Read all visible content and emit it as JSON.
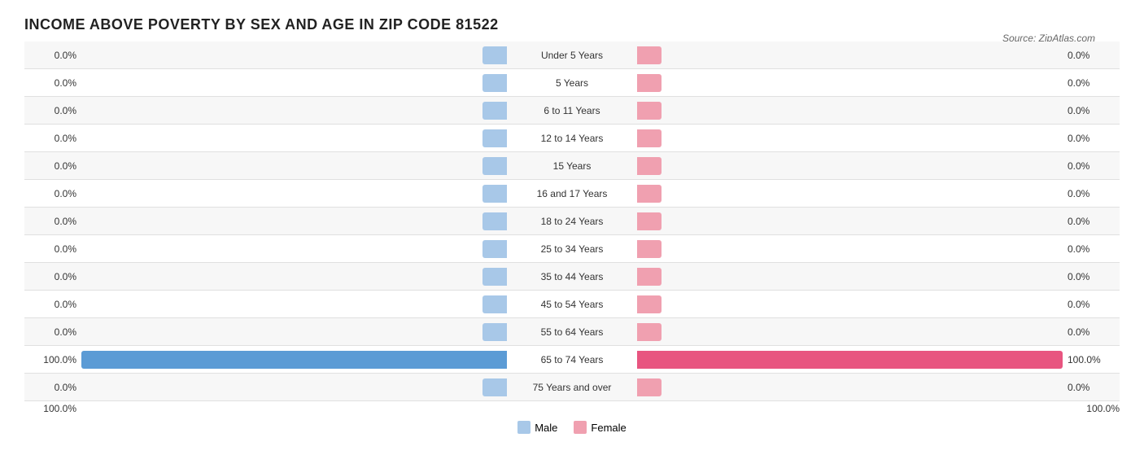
{
  "title": "INCOME ABOVE POVERTY BY SEX AND AGE IN ZIP CODE 81522",
  "source": "Source: ZipAtlas.com",
  "chart": {
    "rows": [
      {
        "label": "Under 5 Years",
        "male": 0.0,
        "female": 0.0,
        "maleDisplay": "0.0%",
        "femaleDisplay": "0.0%",
        "highlight": false
      },
      {
        "label": "5 Years",
        "male": 0.0,
        "female": 0.0,
        "maleDisplay": "0.0%",
        "femaleDisplay": "0.0%",
        "highlight": false
      },
      {
        "label": "6 to 11 Years",
        "male": 0.0,
        "female": 0.0,
        "maleDisplay": "0.0%",
        "femaleDisplay": "0.0%",
        "highlight": false
      },
      {
        "label": "12 to 14 Years",
        "male": 0.0,
        "female": 0.0,
        "maleDisplay": "0.0%",
        "femaleDisplay": "0.0%",
        "highlight": false
      },
      {
        "label": "15 Years",
        "male": 0.0,
        "female": 0.0,
        "maleDisplay": "0.0%",
        "femaleDisplay": "0.0%",
        "highlight": false
      },
      {
        "label": "16 and 17 Years",
        "male": 0.0,
        "female": 0.0,
        "maleDisplay": "0.0%",
        "femaleDisplay": "0.0%",
        "highlight": false
      },
      {
        "label": "18 to 24 Years",
        "male": 0.0,
        "female": 0.0,
        "maleDisplay": "0.0%",
        "femaleDisplay": "0.0%",
        "highlight": false
      },
      {
        "label": "25 to 34 Years",
        "male": 0.0,
        "female": 0.0,
        "maleDisplay": "0.0%",
        "femaleDisplay": "0.0%",
        "highlight": false
      },
      {
        "label": "35 to 44 Years",
        "male": 0.0,
        "female": 0.0,
        "maleDisplay": "0.0%",
        "femaleDisplay": "0.0%",
        "highlight": false
      },
      {
        "label": "45 to 54 Years",
        "male": 0.0,
        "female": 0.0,
        "maleDisplay": "0.0%",
        "femaleDisplay": "0.0%",
        "highlight": false
      },
      {
        "label": "55 to 64 Years",
        "male": 0.0,
        "female": 0.0,
        "maleDisplay": "0.0%",
        "femaleDisplay": "0.0%",
        "highlight": false
      },
      {
        "label": "65 to 74 Years",
        "male": 100.0,
        "female": 100.0,
        "maleDisplay": "100.0%",
        "femaleDisplay": "100.0%",
        "highlight": true
      },
      {
        "label": "75 Years and over",
        "male": 0.0,
        "female": 0.0,
        "maleDisplay": "0.0%",
        "femaleDisplay": "0.0%",
        "highlight": false
      }
    ],
    "maxValue": 100,
    "legend": {
      "male_label": "Male",
      "female_label": "Female",
      "male_color": "#a8c8e8",
      "female_color": "#f0a0b0"
    },
    "bottom_male": "100.0%",
    "bottom_female": "100.0%"
  }
}
